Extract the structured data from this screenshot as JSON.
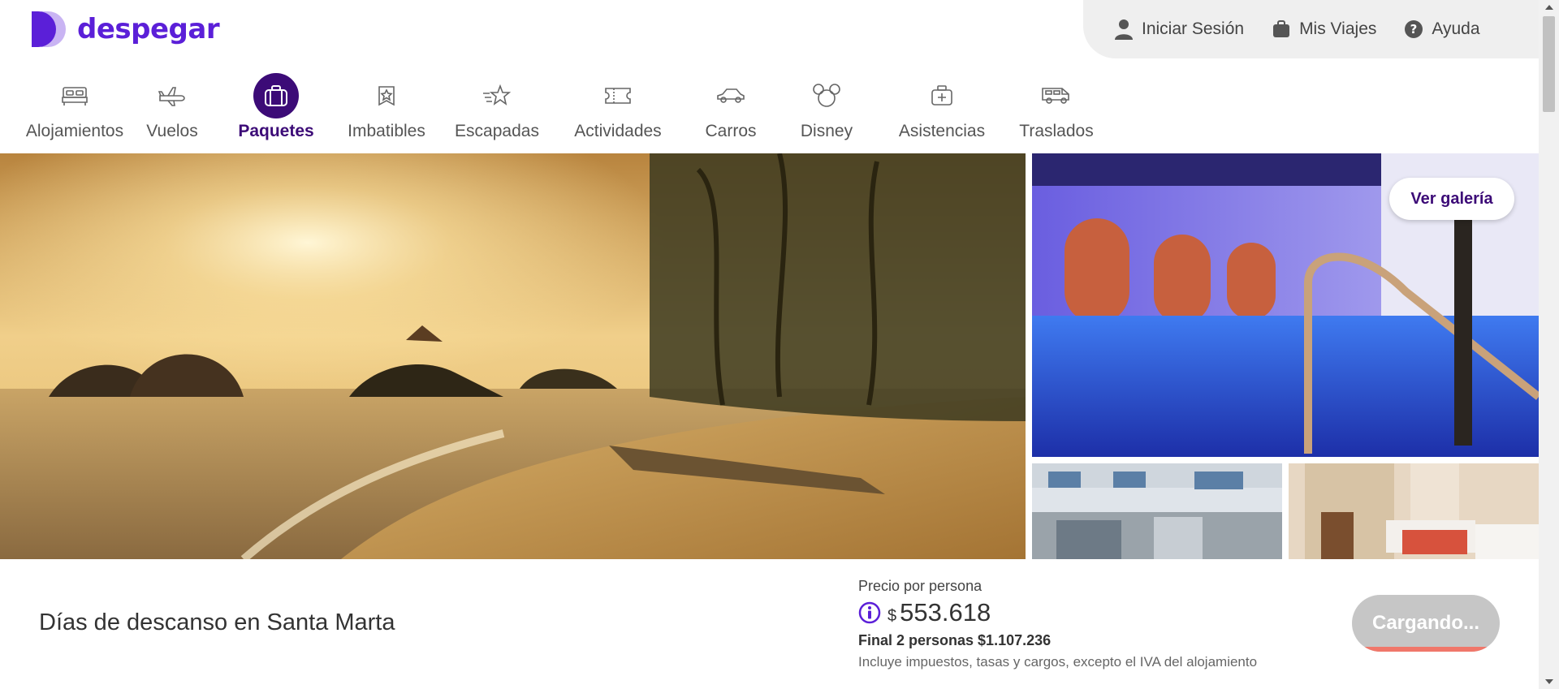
{
  "brand": {
    "name": "despegar",
    "color": "#5b1fd8"
  },
  "userbar": {
    "login": "Iniciar Sesión",
    "trips": "Mis Viajes",
    "help": "Ayuda"
  },
  "nav": {
    "items": [
      {
        "label": "Alojamientos",
        "icon": "bed-icon"
      },
      {
        "label": "Vuelos",
        "icon": "plane-icon"
      },
      {
        "label": "Paquetes",
        "icon": "suitcase-icon",
        "active": true
      },
      {
        "label": "Imbatibles",
        "icon": "badge-star-icon"
      },
      {
        "label": "Escapadas",
        "icon": "star-speed-icon"
      },
      {
        "label": "Actividades",
        "icon": "ticket-icon"
      },
      {
        "label": "Carros",
        "icon": "car-icon"
      },
      {
        "label": "Disney",
        "icon": "mickey-icon"
      },
      {
        "label": "Asistencias",
        "icon": "medkit-icon"
      },
      {
        "label": "Traslados",
        "icon": "van-icon"
      }
    ],
    "active_color": "#3c0b77"
  },
  "gallery": {
    "button": "Ver galería"
  },
  "package": {
    "title": "Días de descanso en Santa Marta",
    "price_label": "Precio por persona",
    "currency": "$",
    "price": "553.618",
    "total": "Final 2 personas $1.107.236",
    "note": "Incluye impuestos, tasas y cargos, excepto el IVA del alojamiento",
    "cta": "Cargando..."
  }
}
